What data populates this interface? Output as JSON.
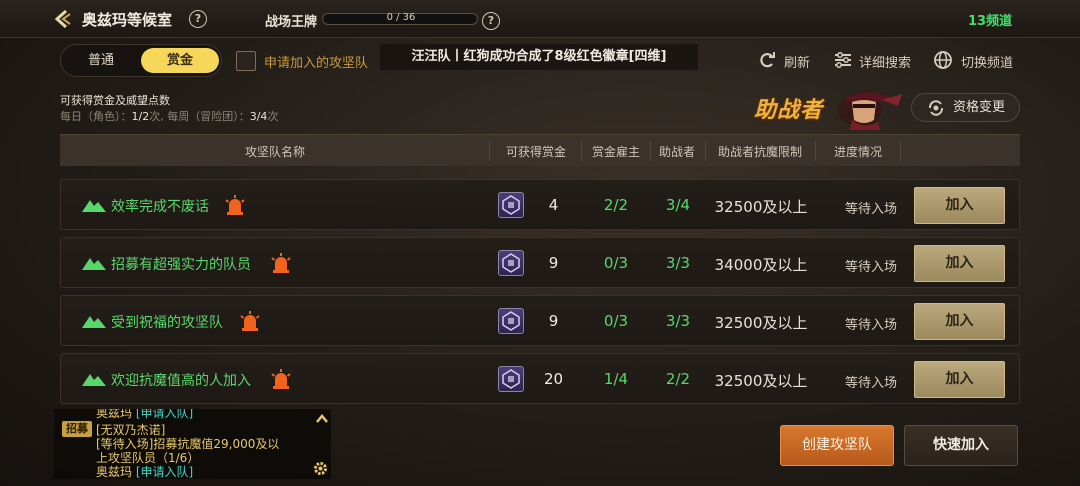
{
  "header": {
    "room_title": "奥兹玛等候室",
    "battlefield_label": "战场王牌",
    "battlefield_progress_text": "0 / 36",
    "battlefield_progress": 0,
    "channel": "13频道"
  },
  "tabs": [
    {
      "label": "普通",
      "selected": false
    },
    {
      "label": "赏金",
      "selected": true
    }
  ],
  "apply_filter": {
    "label": "申请加入的攻坚队",
    "checked": false
  },
  "ticker": "汪汪队丨红狗成功合成了8级红色徽章[四维]",
  "toolbar": {
    "refresh": "刷新",
    "detail_search": "详细搜索",
    "switch_channel": "切换频道"
  },
  "reward_info": {
    "title": "可获得赏金及威望点数",
    "daily_prefix": "每日（角色）：",
    "daily_value": "1/2",
    "daily_suffix": "次, 每周（冒险团）：",
    "weekly_value": "3/4",
    "weekly_suffix": "次"
  },
  "helper_banner": "助战者",
  "qualification_button": "资格变更",
  "table": {
    "columns": [
      "攻坚队名称",
      "可获得赏金",
      "赏金雇主",
      "助战者",
      "助战者抗魔限制",
      "进度情况"
    ],
    "rows": [
      {
        "name": "效率完成不废话",
        "reward": "4",
        "employer": "2/2",
        "helpers": "3/4",
        "resist": "32500及以上",
        "status": "等待入场",
        "join": "加入"
      },
      {
        "name": "招募有超强实力的队员",
        "reward": "9",
        "employer": "0/3",
        "helpers": "3/3",
        "resist": "34000及以上",
        "status": "等待入场",
        "join": "加入"
      },
      {
        "name": "受到祝福的攻坚队",
        "reward": "9",
        "employer": "0/3",
        "helpers": "3/3",
        "resist": "32500及以上",
        "status": "等待入场",
        "join": "加入"
      },
      {
        "name": "欢迎抗魔值高的人加入",
        "reward": "20",
        "employer": "1/4",
        "helpers": "2/2",
        "resist": "32500及以上",
        "status": "等待入场",
        "join": "加入"
      }
    ]
  },
  "chat": {
    "badge": "招募",
    "line0_name": "奥兹玛",
    "line0_link": "[申请入队]",
    "line1": "[无双乃杰诺]",
    "line2": "[等待入场]招募抗魔值29,000及以",
    "line3": "上攻坚队员（1/6）",
    "line4_name": "奥兹玛",
    "line4_link": "[申请入队]"
  },
  "buttons": {
    "create": "创建攻坚队",
    "quick_join": "快速加入"
  },
  "colors": {
    "accent_yellow": "#f6d75a",
    "green_text": "#58d86a",
    "orange_button": "#d8782e",
    "channel_green": "#3fe06a"
  }
}
